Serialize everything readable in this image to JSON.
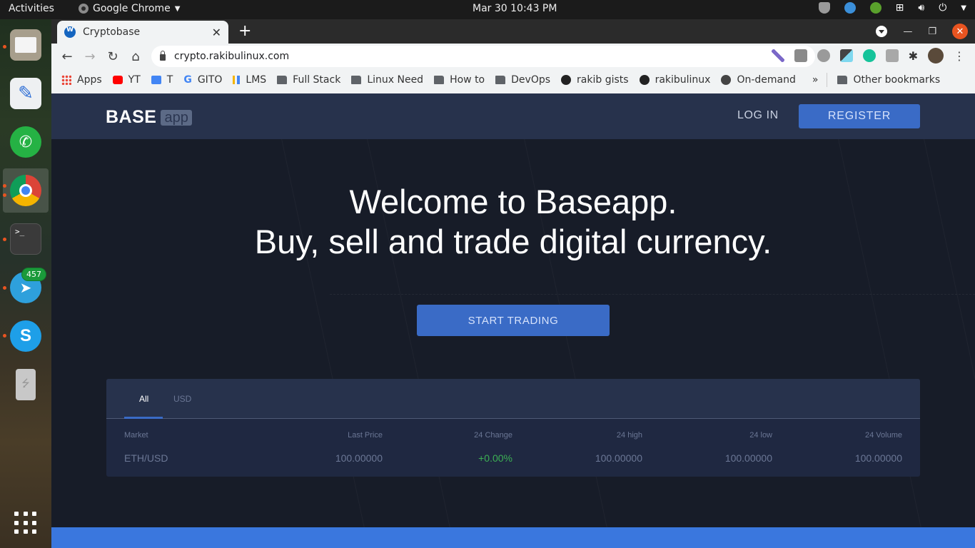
{
  "system": {
    "activities": "Activities",
    "app_menu": "Google Chrome",
    "clock": "Mar 30  10:43 PM"
  },
  "dock": {
    "items": [
      {
        "name": "Files",
        "running": true
      },
      {
        "name": "Text Editor",
        "running": false
      },
      {
        "name": "WhatsApp",
        "running": false
      },
      {
        "name": "Google Chrome",
        "running": true
      },
      {
        "name": "Terminal",
        "running": true
      },
      {
        "name": "Telegram",
        "running": true,
        "badge": "457"
      },
      {
        "name": "Skype",
        "running": true
      },
      {
        "name": "USB Drive",
        "running": false
      }
    ]
  },
  "browser": {
    "tab_title": "Cryptobase",
    "url": "crypto.rakibulinux.com",
    "bookmarks": [
      {
        "label": "Apps",
        "icon": "apps-grid-icon"
      },
      {
        "label": "YT",
        "icon": "youtube-icon"
      },
      {
        "label": "T",
        "icon": "translate-icon"
      },
      {
        "label": "GITO",
        "icon": "google-icon"
      },
      {
        "label": "LMS",
        "icon": "lms-icon"
      },
      {
        "label": "Full Stack",
        "icon": "folder-icon"
      },
      {
        "label": "Linux Need",
        "icon": "folder-icon"
      },
      {
        "label": "How to",
        "icon": "folder-icon"
      },
      {
        "label": "DevOps",
        "icon": "folder-icon"
      },
      {
        "label": "rakib gists",
        "icon": "github-icon"
      },
      {
        "label": "rakibulinux",
        "icon": "github-icon"
      },
      {
        "label": "On-demand",
        "icon": "globe-icon"
      }
    ],
    "more": "»",
    "other_bookmarks": "Other bookmarks"
  },
  "site": {
    "logo_main": "BASE",
    "logo_tag": "app",
    "login": "LOG IN",
    "register": "REGISTER",
    "hero_line1": "Welcome to Baseapp.",
    "hero_line2": "Buy, sell and trade digital currency.",
    "cta": "START TRADING",
    "market": {
      "tabs": [
        {
          "label": "All",
          "active": true
        },
        {
          "label": "USD",
          "active": false
        }
      ],
      "columns": [
        "Market",
        "Last Price",
        "24 Change",
        "24 high",
        "24 low",
        "24 Volume"
      ],
      "rows": [
        {
          "market": "ETH/USD",
          "last_price": "100.00000",
          "change": "+0.00%",
          "high": "100.00000",
          "low": "100.00000",
          "volume": "100.00000"
        }
      ]
    },
    "colors": {
      "accent": "#3a6bc6",
      "positive": "#3cb054",
      "header_bg": "#27324c",
      "page_bg": "#171c28",
      "footer": "#3a77de"
    }
  }
}
